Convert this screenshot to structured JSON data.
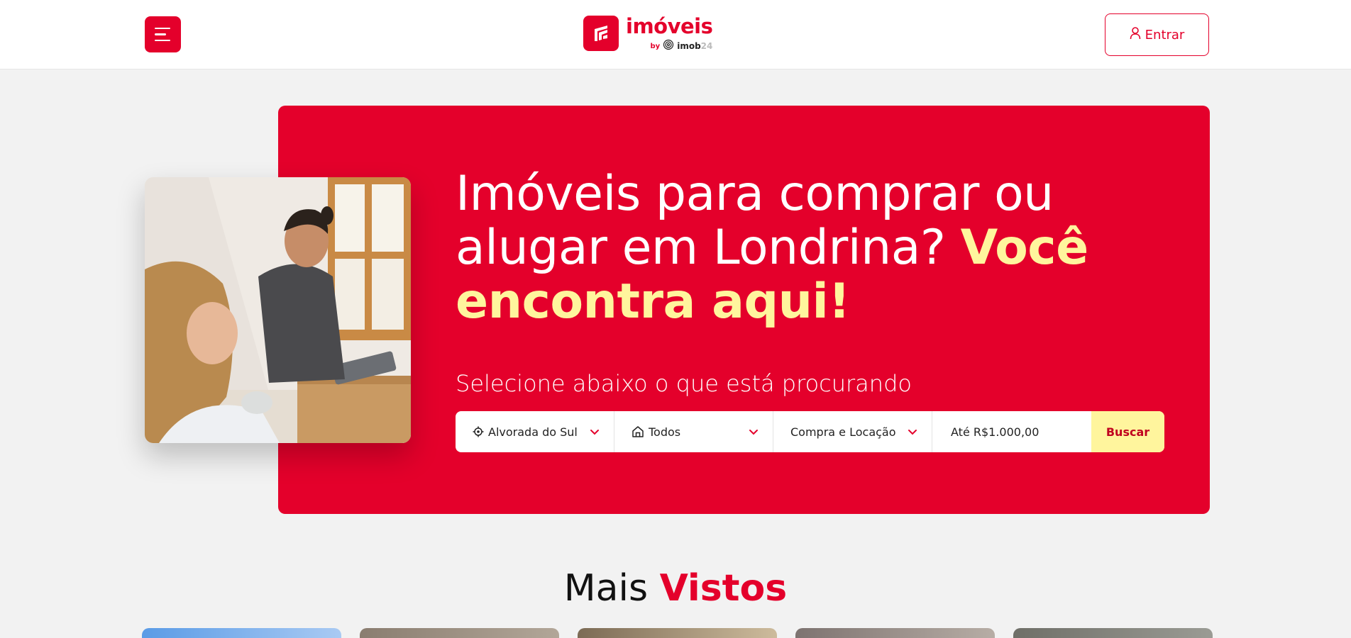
{
  "header": {
    "menu_icon": "hamburger-menu-icon",
    "logo": {
      "word": "imóveis",
      "by": "by",
      "partner_main": "imob",
      "partner_tail": "24"
    },
    "login": {
      "label": "Entrar",
      "icon": "user-icon"
    }
  },
  "hero": {
    "title_plain": "Imóveis para comprar ou alugar em Londrina?",
    "title_highlight": "Você encontra aqui!",
    "subtitle": "Selecione abaixo o que está procurando",
    "search": {
      "location": {
        "value": "Alvorada do Sul",
        "icon": "location-target-icon"
      },
      "property_type": {
        "value": "Todos",
        "icon": "house-icon"
      },
      "transaction": {
        "value": "Compra e Locação"
      },
      "price": {
        "value": "Até R$1.000,00"
      },
      "button_label": "Buscar"
    }
  },
  "most_viewed": {
    "title_plain": "Mais",
    "title_highlight": "Vistos"
  },
  "colors": {
    "brand_red": "#e4002b",
    "highlight_yellow": "#fff59d",
    "page_bg": "#f2f2f2"
  }
}
